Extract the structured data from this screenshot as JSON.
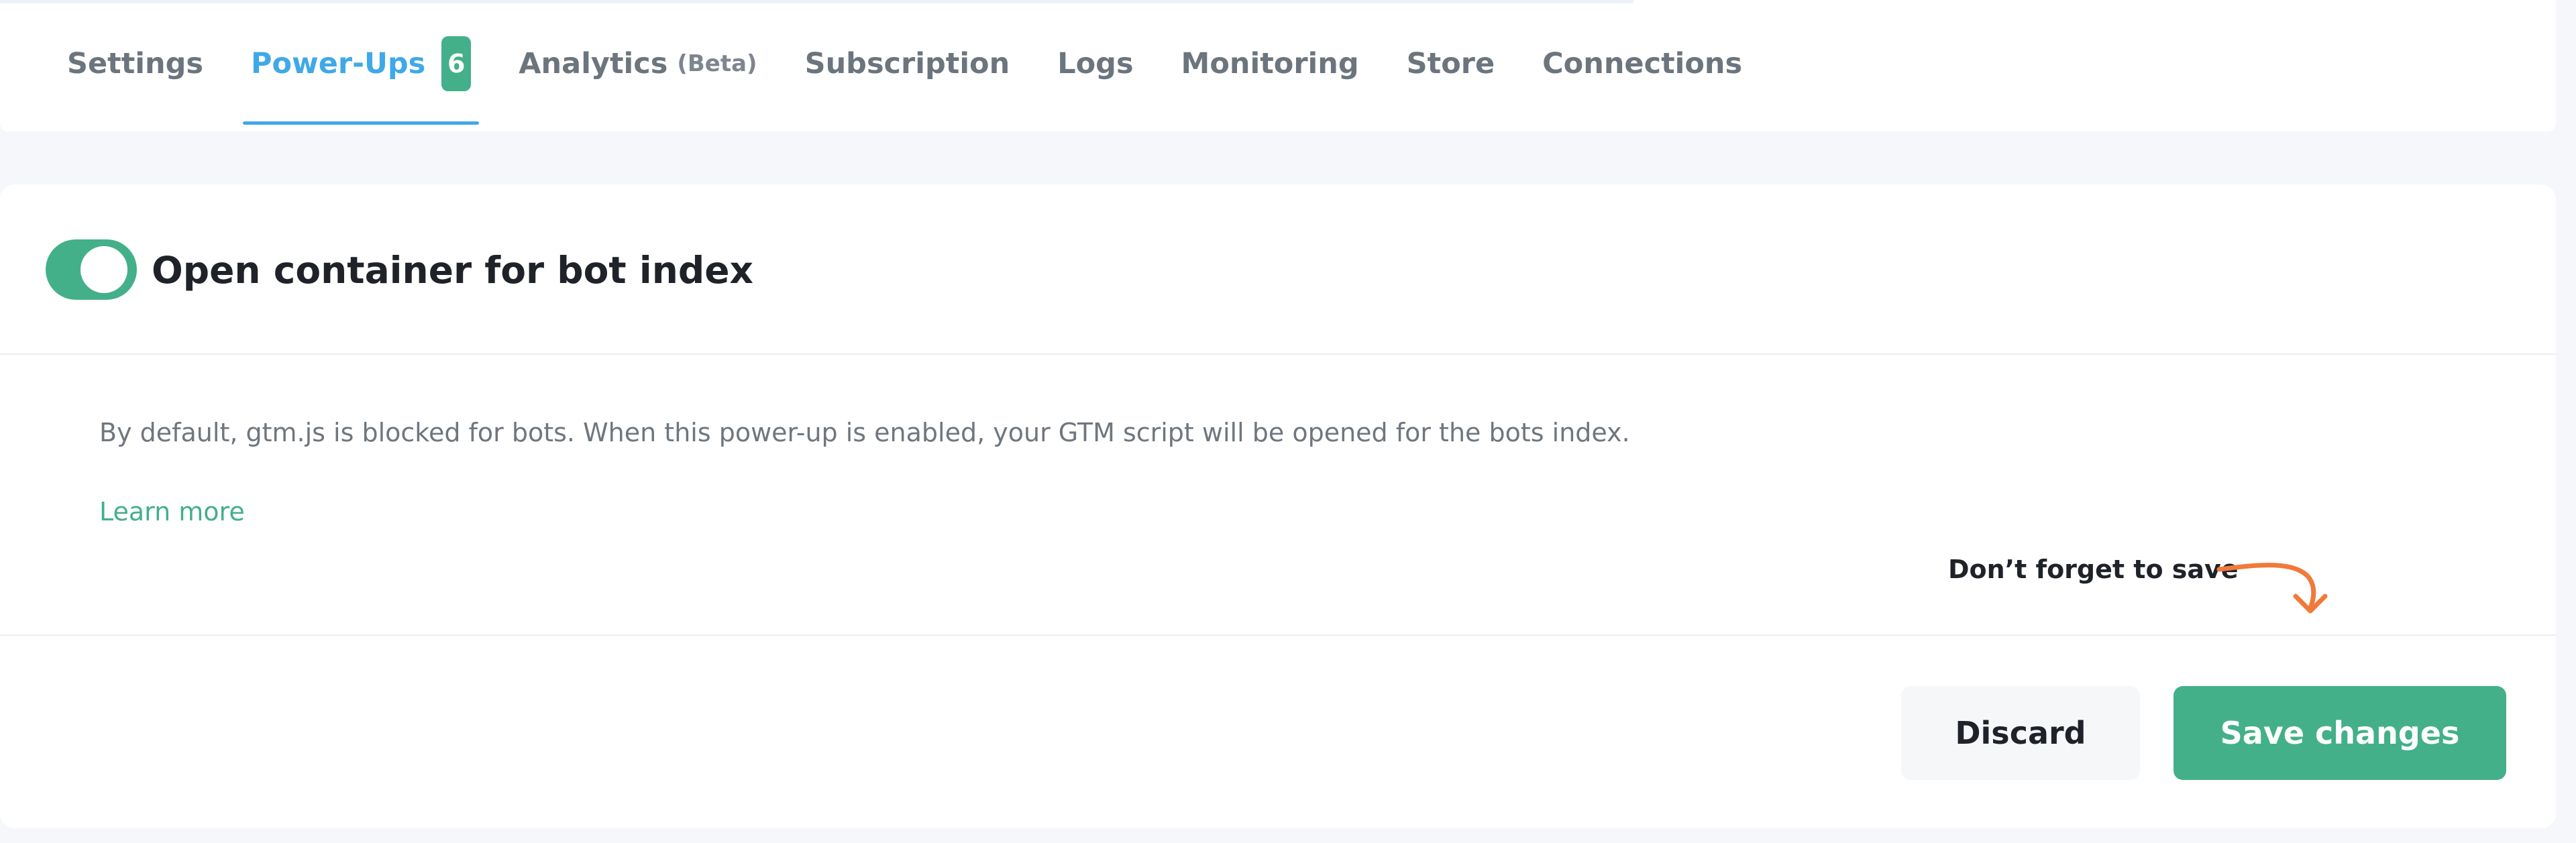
{
  "tabs": {
    "items": [
      {
        "label": "Settings"
      },
      {
        "label": "Power-Ups",
        "count": "6"
      },
      {
        "label": "Analytics",
        "suffix": "(Beta)"
      },
      {
        "label": "Subscription"
      },
      {
        "label": "Logs"
      },
      {
        "label": "Monitoring"
      },
      {
        "label": "Store"
      },
      {
        "label": "Connections"
      }
    ],
    "active": "Power-Ups"
  },
  "power_up": {
    "title": "Open container for bot index",
    "enabled": true,
    "description": "By default, gtm.js is blocked for bots. When this power-up is enabled, your GTM script will be opened for the bots index.",
    "learn_more": "Learn more",
    "reminder": "Don’t forget to save"
  },
  "actions": {
    "discard": "Discard",
    "save": "Save changes"
  },
  "colors": {
    "accent_green": "#43b08a",
    "active_tab_blue": "#3fa9e8",
    "reminder_arrow_orange": "#f07a3a"
  }
}
